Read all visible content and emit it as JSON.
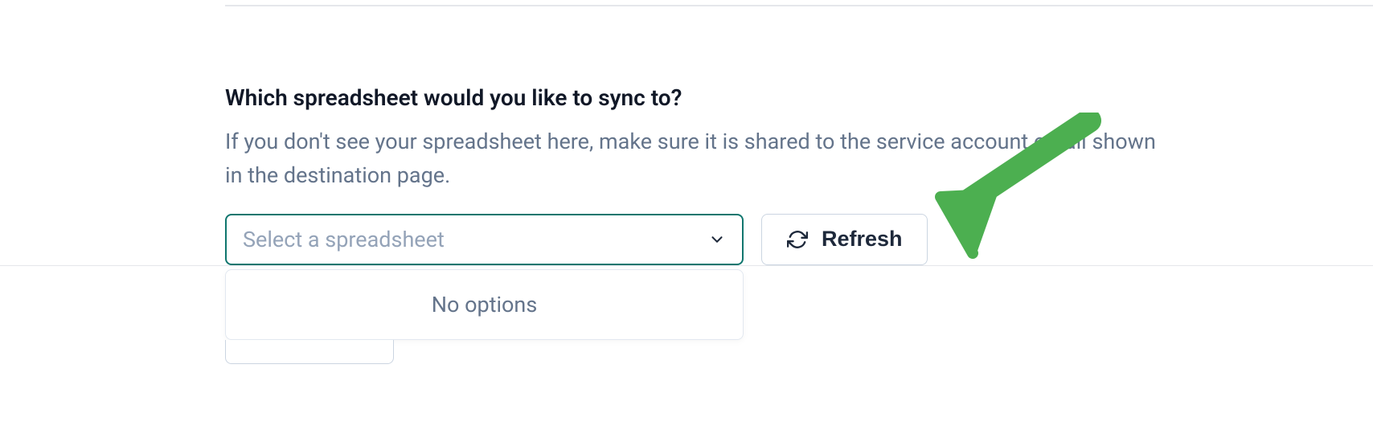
{
  "form": {
    "question": "Which spreadsheet would you like to sync to?",
    "description": "If you don't see your spreadsheet here, make sure it is shared to the service account email shown in the destination page.",
    "select": {
      "placeholder": "Select a spreadsheet",
      "no_options": "No options"
    },
    "refresh_label": "Refresh"
  }
}
